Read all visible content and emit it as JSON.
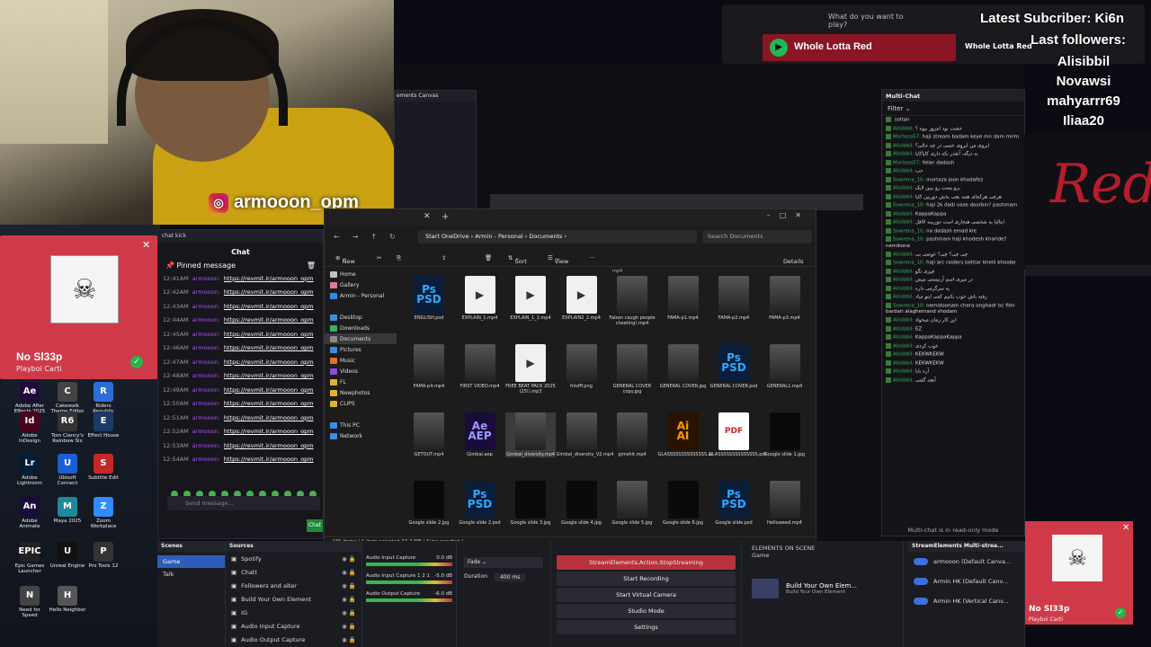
{
  "instagram": {
    "handle": "armooon_opm"
  },
  "stream_overlay": {
    "latest_label": "Latest Subcriber: Ki6n",
    "followers_label": "Last followers:",
    "followers": [
      "Alisibbil",
      "Novawsi",
      "mahyarrr69",
      "Iliaa20"
    ]
  },
  "spotify": {
    "search_placeholder": "What do you want to play?",
    "now_playing": "Whole Lotta Red",
    "playlist_label": "Whole Lotta Red"
  },
  "now_playing_card": {
    "title": "No Sl33p",
    "artist": "Playboi Carti",
    "cover_glyph": "☠"
  },
  "desktop_icons": [
    {
      "label": "Adobe After Effects 2025",
      "color": "#1f0a3a",
      "glyph": "Ae"
    },
    {
      "label": "Cakewalk Theme Editor",
      "color": "#444",
      "glyph": "C"
    },
    {
      "label": "Riders Republic",
      "color": "#2a6fd6",
      "glyph": "R"
    },
    {
      "label": "Adobe InDesign",
      "color": "#49021f",
      "glyph": "Id"
    },
    {
      "label": "Tom Clancy's Rainbow Six",
      "color": "#333",
      "glyph": "R6"
    },
    {
      "label": "Effect House",
      "color": "#1a3a66",
      "glyph": "E"
    },
    {
      "label": "Adobe Lightroom",
      "color": "#001e36",
      "glyph": "Lr"
    },
    {
      "label": "Ubisoft Connect",
      "color": "#1a5fd6",
      "glyph": "U"
    },
    {
      "label": "Subtitle Edit",
      "color": "#c62828",
      "glyph": "S"
    },
    {
      "label": "Adobe Animate",
      "color": "#1a0b3a",
      "glyph": "An"
    },
    {
      "label": "Maya 2025",
      "color": "#1b8a9a",
      "glyph": "M"
    },
    {
      "label": "Zoom Workplace",
      "color": "#2d8cff",
      "glyph": "Z"
    },
    {
      "label": "Epic Games Launcher",
      "color": "#222",
      "glyph": "EPIC"
    },
    {
      "label": "Unreal Engine",
      "color": "#111",
      "glyph": "U"
    },
    {
      "label": "Pro Tools 12",
      "color": "#333",
      "glyph": "P"
    },
    {
      "label": "Need for Speed",
      "color": "#444",
      "glyph": "N"
    },
    {
      "label": "Hello Neighbor",
      "color": "#555",
      "glyph": "H"
    }
  ],
  "kick_chat": {
    "window_title": "chat kick",
    "header": "Chat",
    "pinned_label": "Pinned message",
    "rows": [
      {
        "time": "12:41AM",
        "name": "armooon:",
        "link": "https://revmit.ir/armooon_opm"
      },
      {
        "time": "12:42AM",
        "name": "armooon:",
        "link": "https://revmit.ir/armooon_opm"
      },
      {
        "time": "12:43AM",
        "name": "armooon:",
        "link": "https://revmit.ir/armooon_opm"
      },
      {
        "time": "12:44AM",
        "name": "armooon:",
        "link": "https://revmit.ir/armooon_opm"
      },
      {
        "time": "12:45AM",
        "name": "armooon:",
        "link": "https://revmit.ir/armooon_opm"
      },
      {
        "time": "12:46AM",
        "name": "armooon:",
        "link": "https://revmit.ir/armooon_opm"
      },
      {
        "time": "12:47AM",
        "name": "armooon:",
        "link": "https://revmit.ir/armooon_opm"
      },
      {
        "time": "12:48AM",
        "name": "armooon:",
        "link": "https://revmit.ir/armooon_opm"
      },
      {
        "time": "12:49AM",
        "name": "armooon:",
        "link": "https://revmit.ir/armooon_opm"
      },
      {
        "time": "12:50AM",
        "name": "armooon:",
        "link": "https://revmit.ir/armooon_opm"
      },
      {
        "time": "12:51AM",
        "name": "armooon:",
        "link": "https://revmit.ir/armooon_opm"
      },
      {
        "time": "12:52AM",
        "name": "armooon:",
        "link": "https://revmit.ir/armooon_opm"
      },
      {
        "time": "12:53AM",
        "name": "armooon:",
        "link": "https://revmit.ir/armooon_opm"
      },
      {
        "time": "12:54AM",
        "name": "armooon:",
        "link": "https://revmit.ir/armooon_opm"
      }
    ],
    "input_placeholder": "Send message...",
    "send_label": "Chat"
  },
  "canvas_window": {
    "title": "ements Canvas"
  },
  "multichat": {
    "title": "Multi-Chat",
    "filter_label": "Filter",
    "read_only_note": "Multi-chat is in read-only mode",
    "messages": [
      {
        "user": "",
        "text": "soltan"
      },
      {
        "user": "Alisibbil:",
        "text": "خشت بود امروز بیوه ؟"
      },
      {
        "user": "Morteza57:",
        "text": "haji stream badam keye mn dam mirm"
      },
      {
        "user": "Alisibbil:",
        "text": "ابروی من ابروی خسی در چه حالی؟"
      },
      {
        "user": "Alisibbil:",
        "text": "نه دیگه، آنقدر نکه داری کاپاکاپا"
      },
      {
        "user": "Morteza57:",
        "text": "felan dadash"
      },
      {
        "user": "Alisibbil:",
        "text": "حب"
      },
      {
        "user": "Sowrena_10:",
        "text": "mortaza joon khodafez"
      },
      {
        "user": "Alisibbil:",
        "text": "برو پست رو ببین لایک"
      },
      {
        "user": "Alisibbil:",
        "text": "هرچی هرکجای همه بچی بخش دوربین کاپا"
      },
      {
        "user": "Sowrena_10:",
        "text": "haji 2k dadi vase doorbin? pashmam"
      },
      {
        "user": "Alisibbil:",
        "text": "KappaKappa"
      },
      {
        "user": "Alisibbil:",
        "text": "ایتالیا یه شخصی هنجاری است دوربینه لااقل"
      },
      {
        "user": "Sowrena_10:",
        "text": "na dadash emad kie"
      },
      {
        "user": "Sowrena_10:",
        "text": "pashmam haji khodesh kharide? nemikone"
      },
      {
        "user": "Alisibbil:",
        "text": "چی چی؟ چی؟ عوضی بی"
      },
      {
        "user": "Sowrena_10:",
        "text": "haji arc raiders behtar kheili khoobe"
      },
      {
        "user": "Alisibbil:",
        "text": "چیزی نگو"
      },
      {
        "user": "Alisibbil:",
        "text": "در میزی اسم آرتیستی میش"
      },
      {
        "user": "Alisibbil:",
        "text": "یه سرگرمی داره"
      },
      {
        "user": "Alisibbil:",
        "text": "رفته باش خوب بکنیم کمی اینو میاد"
      },
      {
        "user": "Sowrena_10:",
        "text": "nemidoonam chera onghadr bc film bardari alaghemand shodam"
      },
      {
        "user": "Alisibbil:",
        "text": "این کار زمان میخواد"
      },
      {
        "user": "Alisibbil:",
        "text": "EZ"
      },
      {
        "user": "Alisibbil:",
        "text": "KappaKappaKappa"
      },
      {
        "user": "Alisibbil:",
        "text": "خوب کردی"
      },
      {
        "user": "Alisibbil:",
        "text": "KEKWKEKW"
      },
      {
        "user": "Alisibbil:",
        "text": "KEKWKEKW"
      },
      {
        "user": "Alisibbil:",
        "text": "آره بابا"
      },
      {
        "user": "Alisibbil:",
        "text": "آنچه گفتی"
      }
    ]
  },
  "explorer": {
    "breadcrumb": [
      "Start OneDrive",
      "Armin - Personal",
      "Documents"
    ],
    "search_placeholder": "Search Documents",
    "toolbar": {
      "new": "New",
      "sort": "Sort",
      "view": "View",
      "details": "Details"
    },
    "sidebar": [
      {
        "label": "Home",
        "color": "#c0c0c0"
      },
      {
        "label": "Gallery",
        "color": "#e07aa0"
      },
      {
        "label": "Armin - Personal",
        "color": "#2c8ee6"
      },
      {
        "label": "",
        "color": "transparent"
      },
      {
        "label": "Desktop",
        "color": "#3a8ee6"
      },
      {
        "label": "Downloads",
        "color": "#3ab06a"
      },
      {
        "label": "Documents",
        "color": "#8a8a8a"
      },
      {
        "label": "Pictures",
        "color": "#3a8ee6"
      },
      {
        "label": "Music",
        "color": "#e0702c"
      },
      {
        "label": "Videos",
        "color": "#8a4ae0"
      },
      {
        "label": "FL",
        "color": "#e0b42c"
      },
      {
        "label": "Newphotos",
        "color": "#e0b42c"
      },
      {
        "label": "CLIPS",
        "color": "#e0b42c"
      },
      {
        "label": "",
        "color": "transparent"
      },
      {
        "label": "This PC",
        "color": "#3a8ee6"
      },
      {
        "label": "Network",
        "color": "#3a8ee6"
      }
    ],
    "top_label": "mp4",
    "files": [
      {
        "name": "ENGLISH.psd",
        "kind": "psd",
        "glyph": "Ps\nPSD"
      },
      {
        "name": "EXPLAIN_1.mp4",
        "kind": "vid",
        "glyph": "▶"
      },
      {
        "name": "EXPLAIN_1_1.mp4",
        "kind": "vid",
        "glyph": "▶"
      },
      {
        "name": "EXPLAIN2_2.mp4",
        "kind": "vid",
        "glyph": "▶"
      },
      {
        "name": "Falzan caugh people cheeting!.mp4",
        "kind": "img",
        "glyph": ""
      },
      {
        "name": "FAMA-p1.mp4",
        "kind": "img",
        "glyph": ""
      },
      {
        "name": "FAMA-p2.mp4",
        "kind": "img",
        "glyph": ""
      },
      {
        "name": "FAMA-p3.mp4",
        "kind": "img",
        "glyph": ""
      },
      {
        "name": "FAMA-p4.mp4",
        "kind": "img",
        "glyph": ""
      },
      {
        "name": "FIRST VIDEO.mp4",
        "kind": "img",
        "glyph": ""
      },
      {
        "name": "FREE BEAT PACK 2025 (25!).mp3",
        "kind": "vid",
        "glyph": "▶"
      },
      {
        "name": "fnlsfff.png",
        "kind": "img",
        "glyph": ""
      },
      {
        "name": "GENERAL COVER copy.jpg",
        "kind": "img",
        "glyph": ""
      },
      {
        "name": "GENERAL COVER.jpg",
        "kind": "img",
        "glyph": ""
      },
      {
        "name": "GENERAL COVER.psd",
        "kind": "psd",
        "glyph": "Ps\nPSD"
      },
      {
        "name": "GENERAL1.mp4",
        "kind": "img",
        "glyph": ""
      },
      {
        "name": "GETOUT.mp4",
        "kind": "img",
        "glyph": ""
      },
      {
        "name": "Gimbal.aep",
        "kind": "ae",
        "glyph": "Ae\nAEP"
      },
      {
        "name": "Gimbal_diversity.mp4",
        "kind": "img",
        "glyph": ""
      },
      {
        "name": "Gimbal_diversity_V2.mp4",
        "kind": "img",
        "glyph": ""
      },
      {
        "name": "gimshit.mp4",
        "kind": "img",
        "glyph": ""
      },
      {
        "name": "GLASSSSSSSSSSSSSS.ai",
        "kind": "ai",
        "glyph": "Ai\nAI"
      },
      {
        "name": "GLASSSSSSSSSSSSSS.pdf",
        "kind": "pdf",
        "glyph": "PDF"
      },
      {
        "name": "Google slide 1.jpg",
        "kind": "blk",
        "glyph": ""
      },
      {
        "name": "Google slide 2.jpg",
        "kind": "blk",
        "glyph": ""
      },
      {
        "name": "Google slide 2.psd",
        "kind": "psd",
        "glyph": "Ps\nPSD"
      },
      {
        "name": "Google slide 3.jpg",
        "kind": "blk",
        "glyph": ""
      },
      {
        "name": "Google slide 4.jpg",
        "kind": "blk",
        "glyph": ""
      },
      {
        "name": "Google slide 5.jpg",
        "kind": "img",
        "glyph": ""
      },
      {
        "name": "Google slide 6.jpg",
        "kind": "blk",
        "glyph": ""
      },
      {
        "name": "Google slide.psd",
        "kind": "psd",
        "glyph": "Ps\nPSD"
      },
      {
        "name": "Helloweed.mp4",
        "kind": "img",
        "glyph": ""
      }
    ],
    "status": "235 items  |  1 item selected 37.7 MB  |  Sync pending  |"
  },
  "obs": {
    "scenes_title": "Scenes",
    "scenes": [
      "Game",
      "Talk"
    ],
    "sources_title": "Sources",
    "sources": [
      "Spotify",
      "Chatt",
      "Followers and alter",
      "Build Your Own Element",
      "IG",
      "Audio Input Capture",
      "Audio Output Capture"
    ],
    "mixer": [
      {
        "label": "Audio Input Capture",
        "db": "0.0 dB"
      },
      {
        "label": "Audio Input Capture 1 2 1",
        "db": "-5.0 dB"
      },
      {
        "label": "Audio Output Capture",
        "db": "-6.0 dB"
      }
    ],
    "transition": {
      "type": "Fade",
      "duration_label": "Duration",
      "duration": "400 ms"
    },
    "controls": [
      "StreamElements.Action.StopStreaming",
      "Start Recording",
      "Start Virtual Camera",
      "Studio Mode",
      "Settings"
    ],
    "elements_title": "ELEMENTS ON SCENE",
    "elements_scene": "Game",
    "element_name": "Build Your Own Elem...",
    "element_sub": "Build Your Own Element",
    "multistream_title": "StreamElements Multi-strea...",
    "multistream_rows": [
      "armooon (Default Canva...",
      "Armin HK (Default Canv...",
      "Armin HK (Vertical Canv..."
    ]
  }
}
